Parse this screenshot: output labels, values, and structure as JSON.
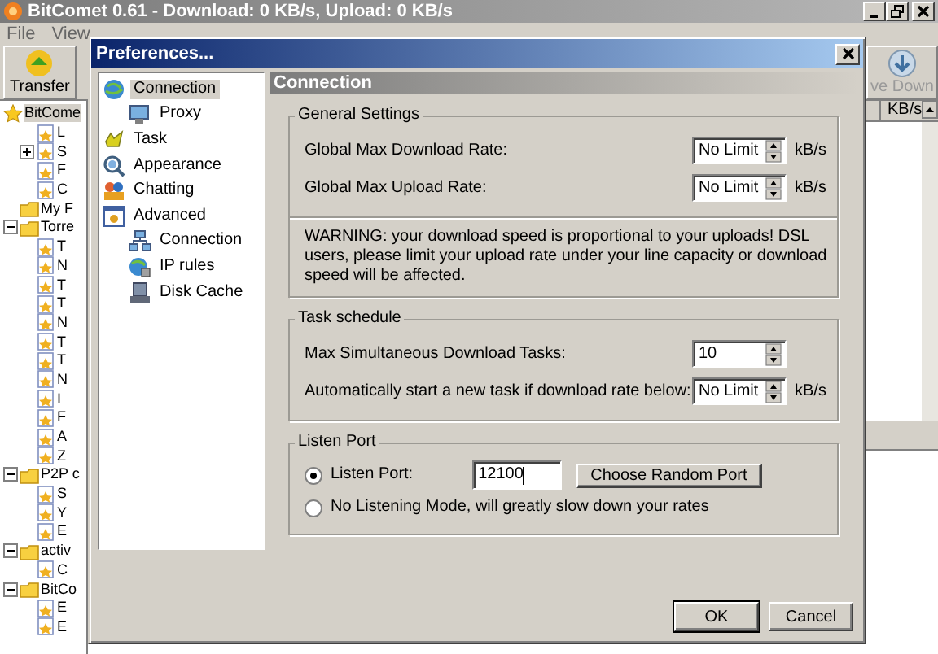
{
  "app_window": {
    "title": "BitComet 0.61 - Download: 0 KB/s, Upload: 0 KB/s",
    "menu": [
      "File",
      "View"
    ],
    "toolbar": [
      {
        "label": "Transfer"
      },
      {
        "label": "ve Down"
      }
    ],
    "tree": [
      {
        "label": "BitCome",
        "kind": "root",
        "selected": true,
        "children": [
          {
            "label": "L",
            "kind": "item",
            "selected": false
          },
          {
            "label": "S",
            "kind": "item",
            "selected": false,
            "expanded": false
          },
          {
            "label": "F",
            "kind": "item",
            "selected": false
          },
          {
            "label": "C",
            "kind": "item",
            "selected": false
          }
        ]
      },
      {
        "label": "My F",
        "kind": "folder",
        "selected": false
      },
      {
        "label": "Torre",
        "kind": "folder",
        "selected": false,
        "expanded": true,
        "children": [
          {
            "label": "T",
            "kind": "item",
            "selected": false
          },
          {
            "label": "N",
            "kind": "item",
            "selected": false
          },
          {
            "label": "T",
            "kind": "item",
            "selected": false
          },
          {
            "label": "T",
            "kind": "item",
            "selected": false
          },
          {
            "label": "N",
            "kind": "item",
            "selected": false
          },
          {
            "label": "T",
            "kind": "item",
            "selected": false
          },
          {
            "label": "T",
            "kind": "item",
            "selected": false
          },
          {
            "label": "N",
            "kind": "item",
            "selected": false
          },
          {
            "label": "I",
            "kind": "item",
            "selected": false
          },
          {
            "label": "F",
            "kind": "item",
            "selected": false
          },
          {
            "label": "A",
            "kind": "item",
            "selected": false
          },
          {
            "label": "Z",
            "kind": "item",
            "selected": false
          }
        ]
      },
      {
        "label": "P2P c",
        "kind": "folder",
        "selected": false,
        "expanded": true,
        "children": [
          {
            "label": "S",
            "kind": "item",
            "selected": false
          },
          {
            "label": "Y",
            "kind": "item",
            "selected": false
          },
          {
            "label": "E",
            "kind": "item",
            "selected": false
          }
        ]
      },
      {
        "label": "activ",
        "kind": "folder",
        "selected": false,
        "expanded": true,
        "children": [
          {
            "label": "C",
            "kind": "item",
            "selected": false
          }
        ]
      },
      {
        "label": "BitCo",
        "kind": "folder",
        "selected": false,
        "expanded": true,
        "children": [
          {
            "label": "E",
            "kind": "item",
            "selected": false
          },
          {
            "label": "E",
            "kind": "item",
            "selected": false
          }
        ]
      }
    ],
    "list_columns": [
      "KB/s"
    ]
  },
  "dialog": {
    "title": "Preferences...",
    "nav": [
      {
        "label": "Connection",
        "selected": true,
        "children": [
          {
            "label": "Proxy",
            "selected": false
          }
        ]
      },
      {
        "label": "Task",
        "selected": false
      },
      {
        "label": "Appearance",
        "selected": false
      },
      {
        "label": "Chatting",
        "selected": false
      },
      {
        "label": "Advanced",
        "selected": false,
        "children": [
          {
            "label": "Connection",
            "selected": false
          },
          {
            "label": "IP rules",
            "selected": false
          },
          {
            "label": "Disk Cache",
            "selected": false
          }
        ]
      }
    ],
    "panel_title": "Connection",
    "groups": [
      {
        "title": "General Settings",
        "kind": "fields",
        "rows": [
          {
            "label": "Global Max Download Rate:",
            "value": "No Limit",
            "unit": "kB/s"
          },
          {
            "label": "Global Max Upload Rate:",
            "value": "No Limit",
            "unit": "kB/s"
          }
        ],
        "note": "WARNING: your download speed is proportional to your uploads! DSL users, please limit your upload rate under your line capacity or download speed will be affected."
      },
      {
        "title": "Task schedule",
        "kind": "fields",
        "rows": [
          {
            "label": "Max Simultaneous Download Tasks:",
            "value": "10"
          },
          {
            "label": "Automatically start a new task if download rate below:",
            "value": "No Limit",
            "unit": "kB/s"
          }
        ]
      },
      {
        "title": "Listen Port",
        "kind": "radios",
        "options": [
          {
            "label": "Listen Port:",
            "selected": true,
            "value": "12100",
            "button": "Choose Random Port"
          },
          {
            "label": "No Listening Mode, will greatly slow down your rates",
            "selected": false
          }
        ]
      }
    ],
    "buttons": [
      {
        "label": "OK",
        "default": true
      },
      {
        "label": "Cancel",
        "default": false
      }
    ]
  }
}
